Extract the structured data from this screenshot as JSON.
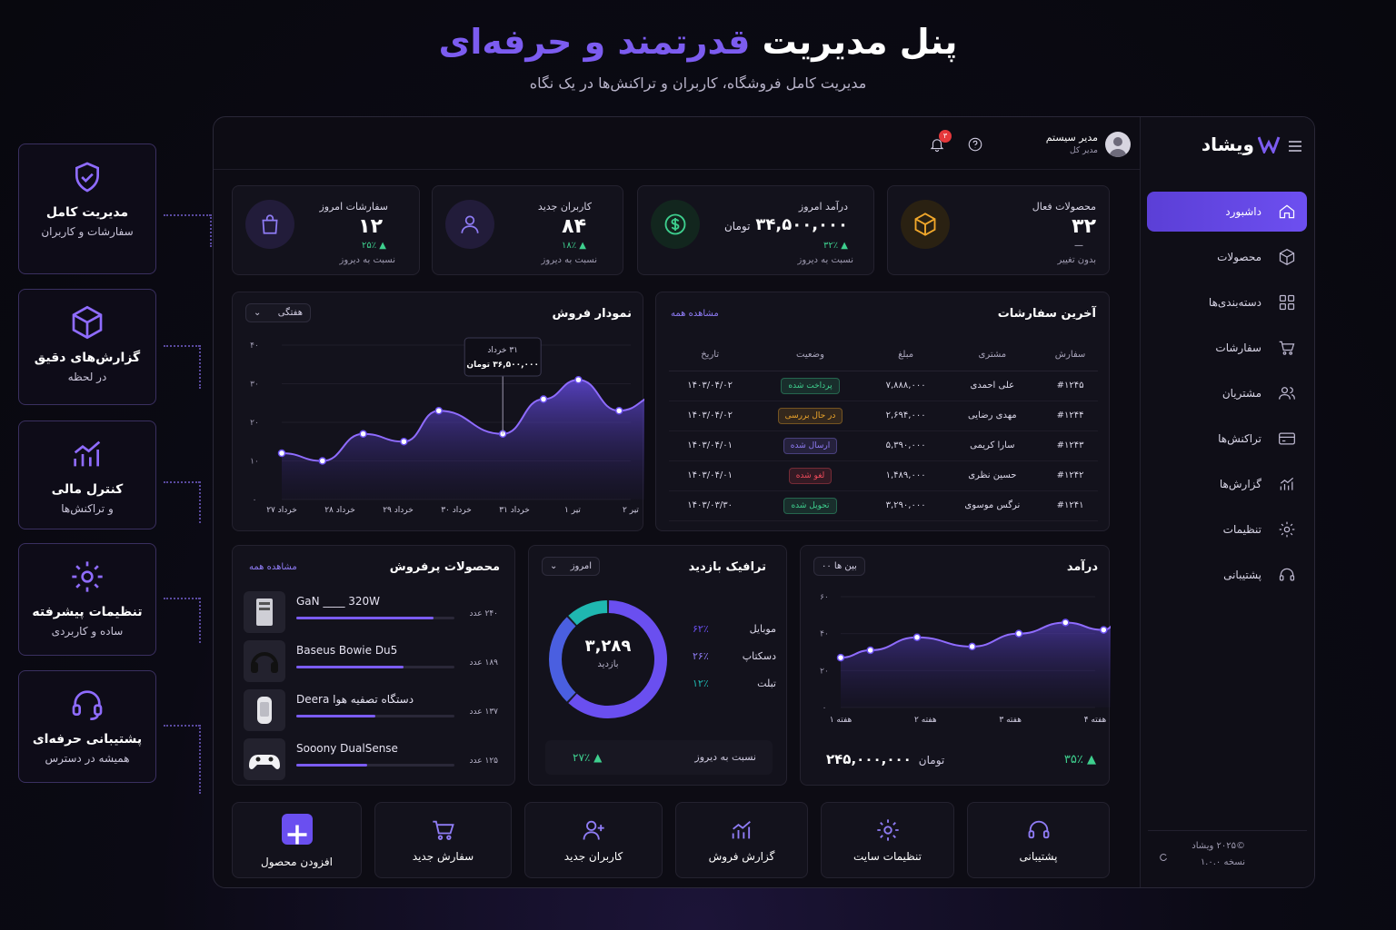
{
  "hero": {
    "title_part1": "پنل مدیریت",
    "title_part2": "قدرتمند و حرفه‌ای",
    "subtitle": "مدیریت کامل فروشگاه، کاربران و تراکنش‌ها در یک نگاه"
  },
  "features": [
    {
      "title": "مدیریت کامل",
      "sub": "سفارشات و کاربران",
      "icon": "shield-check-icon"
    },
    {
      "title": "گزارش‌های دقیق",
      "sub": "در لحظه",
      "icon": "box-icon"
    },
    {
      "title": "کنترل مالی",
      "sub": "و تراکنش‌ها",
      "icon": "chart-up-icon"
    },
    {
      "title": "تنظیمات پیشرفته",
      "sub": "ساده و کاربردی",
      "icon": "gear-icon"
    },
    {
      "title": "پشتیبانی حرفه‌ای",
      "sub": "همیشه در دسترس",
      "icon": "headset-icon"
    }
  ],
  "sidebar": {
    "brand": "ویشاد",
    "items": [
      {
        "label": "داشبورد",
        "icon": "home-icon",
        "active": true
      },
      {
        "label": "محصولات",
        "icon": "box-icon"
      },
      {
        "label": "دسته‌بندی‌ها",
        "icon": "grid-icon"
      },
      {
        "label": "سفارشات",
        "icon": "cart-icon"
      },
      {
        "label": "مشتریان",
        "icon": "users-icon"
      },
      {
        "label": "تراکنش‌ها",
        "icon": "card-icon"
      },
      {
        "label": "گزارش‌ها",
        "icon": "chart-icon"
      },
      {
        "label": "تنظیمات",
        "icon": "gear-icon"
      },
      {
        "label": "پشتیبانی",
        "icon": "headset-icon"
      }
    ],
    "copyright": "©۲۰۲۵ ویشاد",
    "version": "نسخه ۱.۰.۰"
  },
  "topbar": {
    "user_name": "مدیر سیستم",
    "user_role": "مدیر کل",
    "notif_count": "۳"
  },
  "stats": [
    {
      "title": "محصولات فعال",
      "value": "۳۲",
      "change": "—",
      "note": "بدون تغییر",
      "color": "#f0a72b"
    },
    {
      "title": "درآمد امروز",
      "value": "۳۴,۵۰۰,۰۰۰",
      "unit": "تومان",
      "change": "▲ ۳۲٪",
      "note": "نسبت به دیروز",
      "color": "#3ecf8e"
    },
    {
      "title": "کاربران جدید",
      "value": "۸۴",
      "change": "▲ ۱۸٪",
      "note": "نسبت به دیروز",
      "color": "#8f7cf5"
    },
    {
      "title": "سفارشات امروز",
      "value": "۱۲",
      "change": "▲ ۲۵٪",
      "note": "نسبت به دیروز",
      "color": "#8f7cf5"
    }
  ],
  "orders": {
    "title": "آخرین سفارشات",
    "view_all": "مشاهده همه",
    "headers": [
      "سفارش",
      "مشتری",
      "مبلغ",
      "وضعیت",
      "تاریخ"
    ],
    "rows": [
      {
        "id": "#۱۲۴۵",
        "customer": "علی احمدی",
        "amount": "۷,۸۸۸,۰۰۰",
        "status": "پرداخت شده",
        "status_color": "#3ecf8e",
        "date": "۱۴۰۳/۰۴/۰۲"
      },
      {
        "id": "#۱۲۴۴",
        "customer": "مهدی رضایی",
        "amount": "۲,۶۹۴,۰۰۰",
        "status": "در حال بررسی",
        "status_color": "#f0a72b",
        "date": "۱۴۰۳/۰۴/۰۲"
      },
      {
        "id": "#۱۲۴۳",
        "customer": "سارا کریمی",
        "amount": "۵,۳۹۰,۰۰۰",
        "status": "ارسال شده",
        "status_color": "#8f7cf5",
        "date": "۱۴۰۳/۰۴/۰۱"
      },
      {
        "id": "#۱۲۴۲",
        "customer": "حسین نظری",
        "amount": "۱,۴۸۹,۰۰۰",
        "status": "لغو شده",
        "status_color": "#ef4b5a",
        "date": "۱۴۰۳/۰۴/۰۱"
      },
      {
        "id": "#۱۲۴۱",
        "customer": "نرگس موسوی",
        "amount": "۳,۲۹۰,۰۰۰",
        "status": "تحویل شده",
        "status_color": "#3ecf8e",
        "date": "۱۴۰۳/۰۳/۳۰"
      }
    ]
  },
  "sales": {
    "title": "نمودار فروش",
    "period": "هفتگی",
    "tooltip_date": "۳۱ خرداد",
    "tooltip_value": "۳۶,۵۰۰,۰۰۰ تومان"
  },
  "bestsellers": {
    "title": "محصولات پرفروش",
    "view_all": "مشاهده همه",
    "items": [
      {
        "name": "GaN ____ 320W",
        "count": "۲۴۰ عدد",
        "ratio": 0.87
      },
      {
        "name": "Baseus Bowie Du5",
        "count": "۱۸۹ عدد",
        "ratio": 0.68
      },
      {
        "name": "Deera دستگاه تصفیه هوا",
        "count": "۱۳۷ عدد",
        "ratio": 0.5
      },
      {
        "name": "Sooony DualSense",
        "count": "۱۲۵ عدد",
        "ratio": 0.45
      }
    ]
  },
  "traffic": {
    "title": "ترافیک بازدید",
    "period": "امروز",
    "total": "۳,۲۸۹",
    "total_label": "بازدید",
    "rows": [
      {
        "label": "موبایل",
        "pct": "۶۲٪",
        "value": 62,
        "color": "#6a4ff0"
      },
      {
        "label": "دسکتاپ",
        "pct": "۲۶٪",
        "value": 26,
        "color": "#8f7cf5"
      },
      {
        "label": "تبلت",
        "pct": "۱۲٪",
        "value": 12,
        "color": "#1fb7b0"
      }
    ],
    "change": "▲ ۲۷٪",
    "note": "نسبت به دیروز"
  },
  "income": {
    "title": "درآمد",
    "period": "بین ها ۰۰",
    "total": "۲۴۵,۰۰۰,۰۰۰",
    "unit": "تومان",
    "change": "▲ ۳۵٪"
  },
  "quick_actions": [
    {
      "label": "پشتیبانی",
      "icon": "headset-icon"
    },
    {
      "label": "تنظیمات سایت",
      "icon": "gear-icon"
    },
    {
      "label": "گزارش فروش",
      "icon": "chart-up-icon"
    },
    {
      "label": "کاربران جدید",
      "icon": "user-plus-icon"
    },
    {
      "label": "سفارش جدید",
      "icon": "cart-icon"
    },
    {
      "label": "افزودن محصول",
      "icon": "plus-icon"
    }
  ],
  "chart_data": [
    {
      "type": "area",
      "title": "نمودار فروش",
      "x": [
        "۲۷ خرداد",
        "۲۸ خرداد",
        "۲۹ خرداد",
        "۳۰ خرداد",
        "۳۱ خرداد",
        "۱ تیر",
        "۲ تیر"
      ],
      "y_ticks": [
        "۰",
        "۱۰",
        "۲۰",
        "۳۰",
        "۴۰"
      ],
      "ylim": [
        0,
        40
      ],
      "points": [
        [
          0,
          12
        ],
        [
          0.7,
          10
        ],
        [
          1.4,
          17
        ],
        [
          2.1,
          15
        ],
        [
          2.7,
          23
        ],
        [
          3.8,
          17
        ],
        [
          4.5,
          26
        ],
        [
          5.1,
          31
        ],
        [
          5.8,
          23
        ],
        [
          6.5,
          27
        ]
      ]
    },
    {
      "type": "area",
      "title": "درآمد",
      "x": [
        "هفته ۱",
        "هفته ۲",
        "هفته ۳",
        "هفته ۴"
      ],
      "y_ticks": [
        "۰",
        "۲۰",
        "۴۰",
        "۶۰"
      ],
      "ylim": [
        0,
        60
      ],
      "points": [
        [
          0,
          27
        ],
        [
          0.35,
          31
        ],
        [
          0.9,
          38
        ],
        [
          1.55,
          33
        ],
        [
          2.1,
          40
        ],
        [
          2.65,
          46
        ],
        [
          3.1,
          42
        ],
        [
          3.45,
          60
        ]
      ]
    },
    {
      "type": "pie",
      "title": "ترافیک بازدید",
      "categories": [
        "موبایل",
        "دسکتاپ",
        "تبلت"
      ],
      "values": [
        62,
        26,
        12
      ]
    }
  ]
}
